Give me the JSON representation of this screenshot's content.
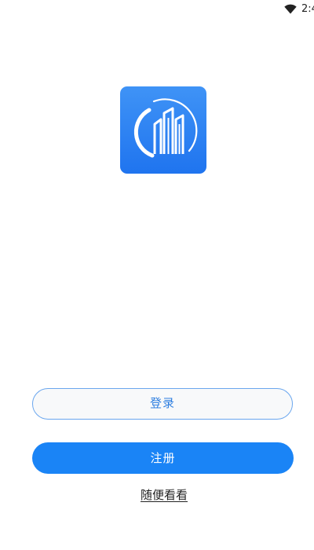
{
  "status_bar": {
    "time": "2:4",
    "icons": [
      "wifi-icon"
    ]
  },
  "logo": {
    "icon": "city-buildings-logo-icon",
    "gradient_top": "#3f93f6",
    "gradient_bottom": "#1f74ef"
  },
  "actions": {
    "login_label": "登录",
    "register_label": "注册",
    "browse_label": "随便看看"
  },
  "colors": {
    "primary": "#1a84f6",
    "outline": "#6aa6ee",
    "outline_text": "#2f7fe0"
  }
}
